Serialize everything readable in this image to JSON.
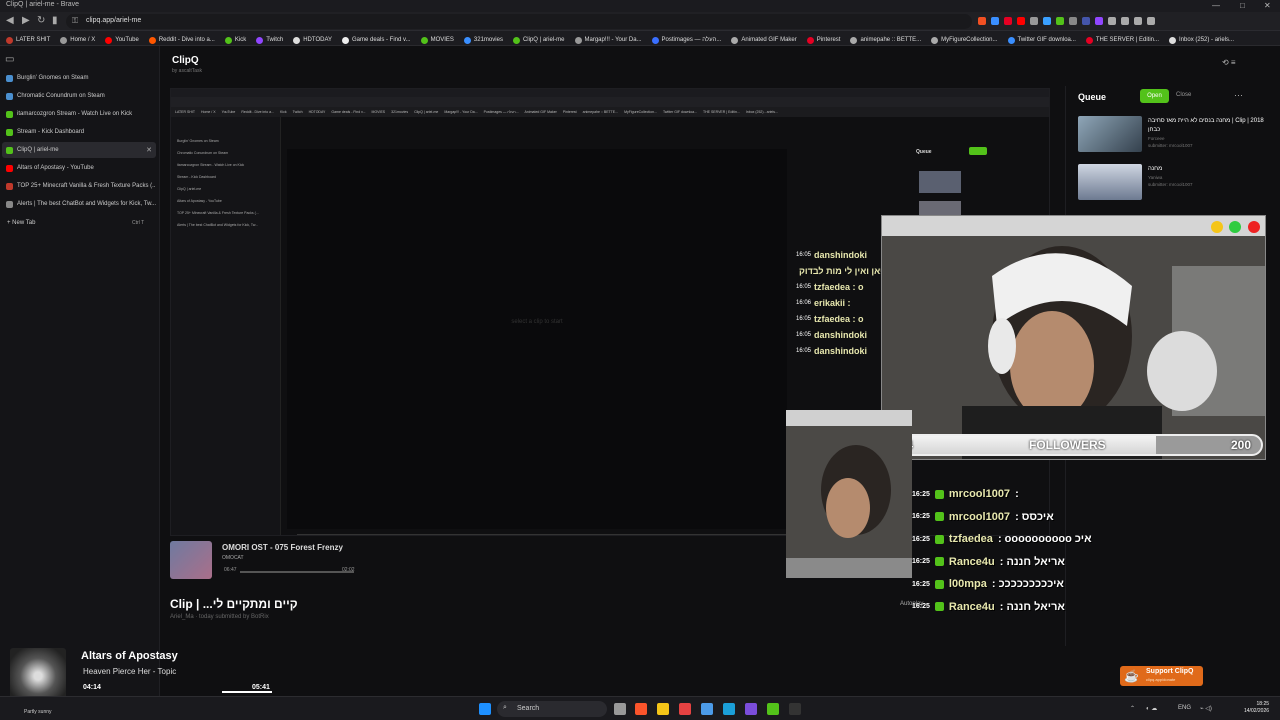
{
  "window": {
    "title": "ClipQ | ariel-me - Brave",
    "url": "clipq.app/ariel-me"
  },
  "bookmarks": [
    {
      "label": "LATER SHIT",
      "color": "#c0392b"
    },
    {
      "label": "Home / X",
      "color": "#999999"
    },
    {
      "label": "YouTube",
      "color": "#ff0000"
    },
    {
      "label": "Reddit - Dive into a...",
      "color": "#ff5700"
    },
    {
      "label": "Kick",
      "color": "#53c21a"
    },
    {
      "label": "Twitch",
      "color": "#9146ff"
    },
    {
      "label": "HDTODAY",
      "color": "#dddddd"
    },
    {
      "label": "Game deals - Find v...",
      "color": "#eeeeee"
    },
    {
      "label": "MOVIES",
      "color": "#53c21a"
    },
    {
      "label": "321movies",
      "color": "#3a8fff"
    },
    {
      "label": "ClipQ | ariel-me",
      "color": "#53c21a"
    },
    {
      "label": "Margap!!! - Your Da...",
      "color": "#999999"
    },
    {
      "label": "Postimages — העלה...",
      "color": "#3a6fff"
    },
    {
      "label": "Animated GIF Maker",
      "color": "#aaaaaa"
    },
    {
      "label": "Pinterest",
      "color": "#e60023"
    },
    {
      "label": "animepahe :: BETTE...",
      "color": "#aaaaaa"
    },
    {
      "label": "MyFigureCollection...",
      "color": "#aaaaaa"
    },
    {
      "label": "Twitter GIF downloa...",
      "color": "#3a8fff"
    },
    {
      "label": "THE SERVER | Editin...",
      "color": "#e60023"
    },
    {
      "label": "Inbox (252) - ariels...",
      "color": "#dddddd"
    }
  ],
  "tabs": [
    {
      "label": "Burglin' Gnomes on Steam",
      "color": "#4a8fcf"
    },
    {
      "label": "Chromatic Conundrum on Steam",
      "color": "#4a8fcf"
    },
    {
      "label": "itamarcozgron Stream - Watch Live on Kick",
      "color": "#53c21a"
    },
    {
      "label": "Stream - Kick Dashboard",
      "color": "#53c21a"
    },
    {
      "label": "ClipQ | ariel-me",
      "color": "#53c21a"
    },
    {
      "label": "Altars of Apostasy - YouTube",
      "color": "#ff0000"
    },
    {
      "label": "TOP 25+ Minecraft Vanilla & Fresh Texture Packs (...",
      "color": "#c0392b"
    },
    {
      "label": "Alerts | The best ChatBot and Widgets for Kick, Tw...",
      "color": "#888888"
    }
  ],
  "newtab": {
    "label": "New Tab",
    "shortcut": "Ctrl T"
  },
  "app": {
    "title": "ClipQ",
    "subtitle": "by ascaltTask"
  },
  "queue": {
    "title": "Queue",
    "open_label": "Open",
    "close_label": "Close",
    "items": [
      {
        "title": "מחנה בנסים לא היית מאז סחיבה | Clip | 2018 כבחן",
        "submitter": "Forceee",
        "meta": "submitter: mrcool1007"
      },
      {
        "title": "מחנה",
        "submitter": "Yaniwa",
        "meta": "submitter: mrcool1007"
      }
    ]
  },
  "nested": {
    "queue_title": "Queue",
    "empty_text": "select a clip to start"
  },
  "followers": {
    "current": "144",
    "label": "FOLLOWERS",
    "goal": "200",
    "progress": 0.72
  },
  "top_chat": [
    {
      "time": "16:05",
      "user": "danshindoki"
    },
    {
      "time": "",
      "user": "ירון פאן ואין לי מות לבדוק"
    },
    {
      "time": "16:05",
      "user": "tzfaedea : o"
    },
    {
      "time": "16:06",
      "user": "erikakii :"
    },
    {
      "time": "16:05",
      "user": "tzfaedea : o"
    },
    {
      "time": "16:05",
      "user": "danshindoki"
    },
    {
      "time": "16:05",
      "user": "danshindoki"
    }
  ],
  "chat": [
    {
      "time": "16:25",
      "user": "mrcool1007",
      "msg": ": "
    },
    {
      "time": "16:25",
      "user": "mrcool1007",
      "msg": ": איכסס"
    },
    {
      "time": "16:25",
      "user": "tzfaedea",
      "msg": ": oooooooooo איכ"
    },
    {
      "time": "16:25",
      "user": "Rance4u",
      "msg": ": אריאל חננה"
    },
    {
      "time": "16:25",
      "user": "l00mpa",
      "msg": ": איכככככככככ"
    },
    {
      "time": "16:25",
      "user": "Rance4u",
      "msg": ": אריאל חננה"
    }
  ],
  "mini_player": {
    "title": "OMORI OST - 075 Forest Frenzy",
    "artist": "OMOCAT",
    "current": "06:47",
    "duration": "02:02"
  },
  "clip": {
    "title": "Clip | ...קיים ומתקיים לי",
    "meta": "Ariel_Ma · today submitted by BotRix"
  },
  "autoplay": "Autoplay",
  "support": {
    "label": "Support ClipQ",
    "link": "clipq.app/donate"
  },
  "now_playing": {
    "title": "Altars of Apostasy",
    "artist": "Heaven Pierce Her - Topic",
    "current": "04:14",
    "duration": "05:41"
  },
  "weather": "Partly sunny",
  "taskbar": {
    "search_label": "Search",
    "lang": "ENG",
    "time": "18:25",
    "date": "14/02/2026"
  }
}
